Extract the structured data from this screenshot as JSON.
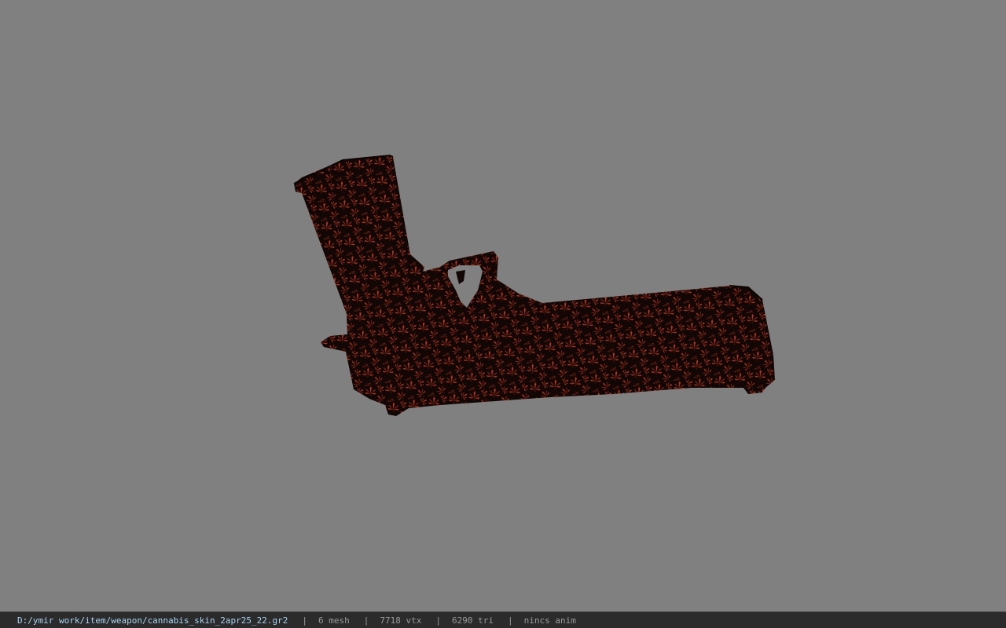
{
  "viewport": {
    "background": "#808080",
    "model": {
      "object": "pistol-model",
      "skin_base_color": "#130705",
      "skin_leaf_color": "#b33517"
    }
  },
  "status_bar": {
    "file_path": "D:/ymir work/item/weapon/cannabis_skin_2apr25_22.gr2",
    "separator": "|",
    "mesh_count": "6 mesh",
    "vertex_count": "7718 vtx",
    "triangle_count": "6290 tri",
    "animation": "nincs anim"
  }
}
